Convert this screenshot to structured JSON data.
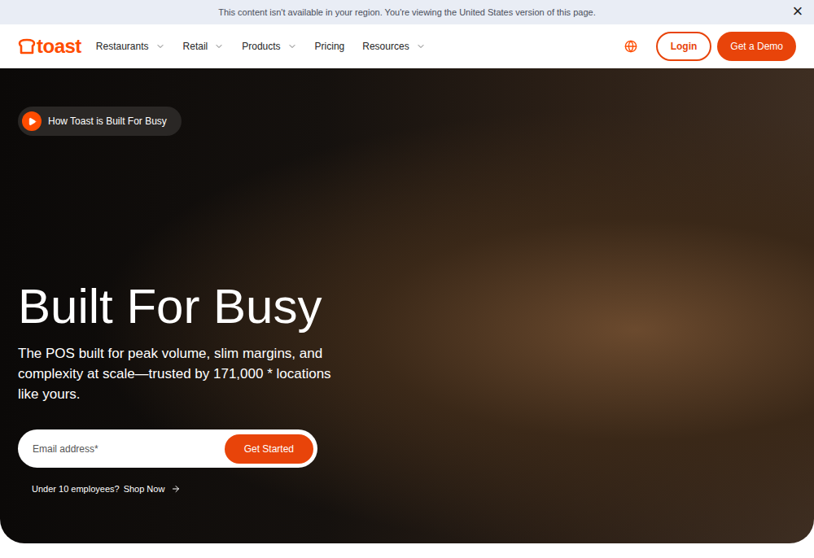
{
  "banner": {
    "text": "This content isn't available in your region. You're viewing the United States version of this page.",
    "close": "×"
  },
  "nav": {
    "logo": "toast",
    "items": [
      {
        "label": "Restaurants",
        "dropdown": true
      },
      {
        "label": "Retail",
        "dropdown": true
      },
      {
        "label": "Products",
        "dropdown": true
      },
      {
        "label": "Pricing",
        "dropdown": false
      },
      {
        "label": "Resources",
        "dropdown": true
      }
    ],
    "login": "Login",
    "demo": "Get a Demo"
  },
  "hero": {
    "video_pill": "How Toast is Built For Busy",
    "heading": "Built For Busy",
    "subheading": "The POS built for peak volume, slim margins, and complexity at scale—trusted by 171,000 * locations like yours.",
    "email_placeholder": "Email address*",
    "cta": "Get Started",
    "small_question": "Under 10 employees?",
    "small_link": "Shop Now"
  }
}
